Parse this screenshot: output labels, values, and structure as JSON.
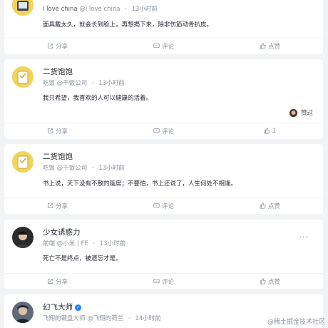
{
  "posts": [
    {
      "author": "i love china",
      "handle": "@i love china",
      "time": "13小时前",
      "content": "面具戴太久，就会长到脸上，再想揭下来，除非伤筋动骨扒皮。",
      "share": "分享",
      "comment": "评论",
      "like": "点赞"
    },
    {
      "author": "二货饱饱",
      "role": "吃饭 @干饭公司",
      "time": "13小时前",
      "content": "我只希望，我喜欢的人可以健康的活着。",
      "liked_text": "赞过",
      "share": "分享",
      "comment": "评论",
      "like": "1"
    },
    {
      "author": "二货饱饱",
      "role": "吃饭 @干饭公司",
      "time": "13小时前",
      "content": "书上说，天下没有不散的筵席；不要怕，书上还说了，人生何处不相逢。",
      "share": "分享",
      "comment": "评论",
      "like": "点赞"
    },
    {
      "author": "少女诱惑力",
      "role": "前端 @小米 | FE",
      "time": "13小时前",
      "content": "死亡不是终点，被遗忘才是。",
      "more": "···",
      "share": "分享",
      "comment": "评论",
      "like": "点赞"
    },
    {
      "author": "幻飞大师",
      "role": "飞翔的键盘大师 @飞翔的荷兰",
      "time": "14小时前"
    }
  ],
  "watermark": "@稀土掘金技术社区",
  "colors": {
    "background": "#f2f3f5",
    "text": "#1d2129",
    "meta": "#8a919f",
    "accent": "#1e80ff"
  }
}
